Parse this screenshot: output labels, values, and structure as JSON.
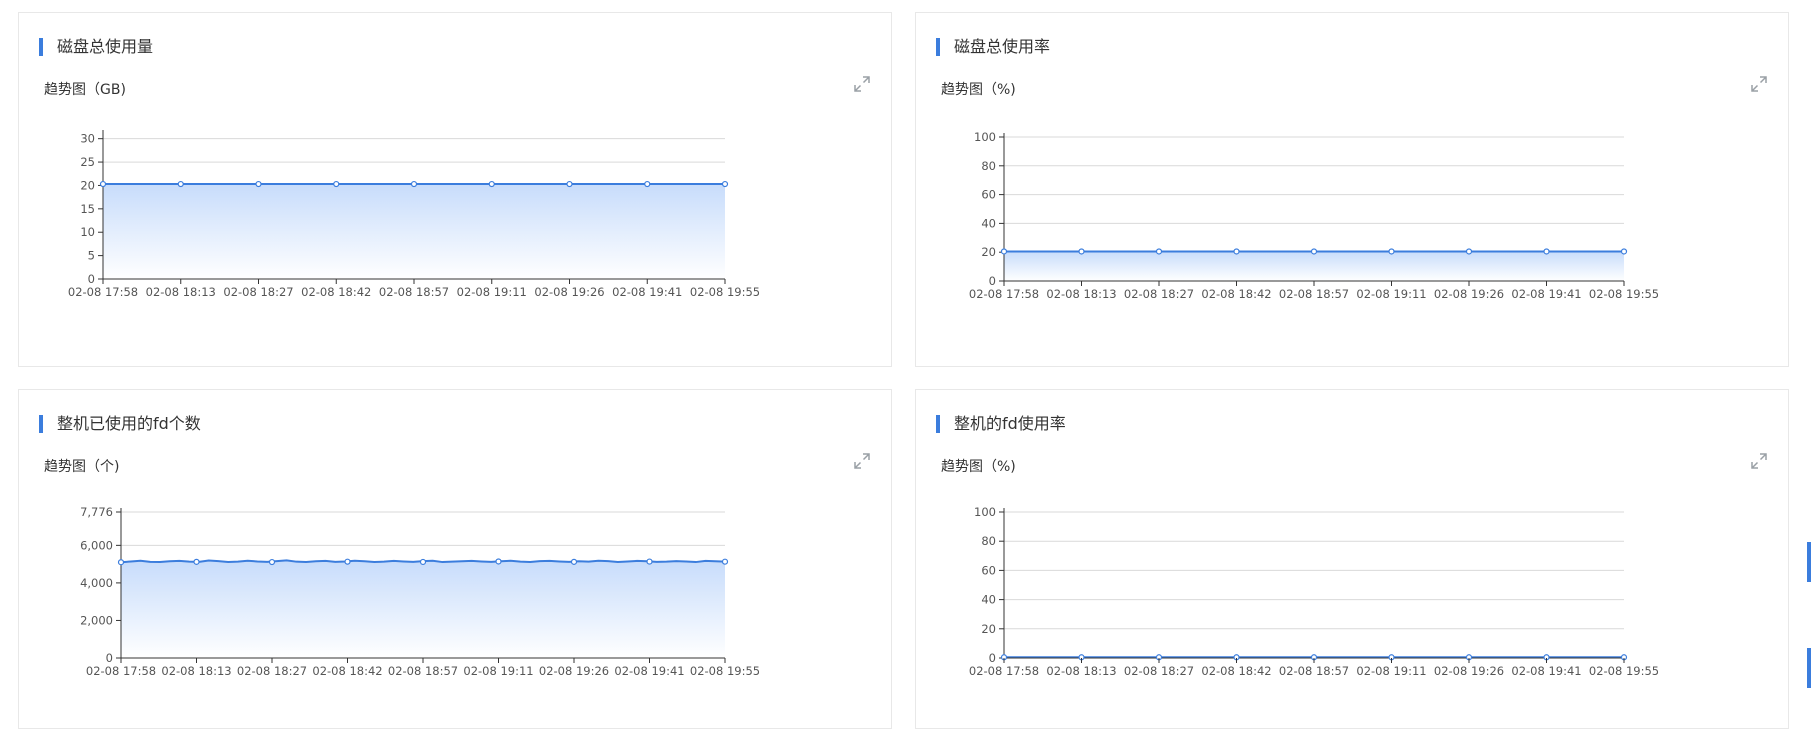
{
  "accent_color": "#3b7ddd",
  "icons": {
    "expand": "expand-icon"
  },
  "panels": [
    {
      "title": "磁盘总使用量",
      "subtitle": "趋势图（GB)"
    },
    {
      "title": "磁盘总使用率",
      "subtitle": "趋势图（%)"
    },
    {
      "title": "整机已使用的fd个数",
      "subtitle": "趋势图（个)"
    },
    {
      "title": "整机的fd使用率",
      "subtitle": "趋势图（%)"
    }
  ],
  "chart_data": [
    {
      "type": "area",
      "title": "磁盘总使用量",
      "x": [
        "02-08 17:58",
        "02-08 18:13",
        "02-08 18:27",
        "02-08 18:42",
        "02-08 18:57",
        "02-08 19:11",
        "02-08 19:26",
        "02-08 19:41",
        "02-08 19:55"
      ],
      "yticks": [
        0,
        5,
        10,
        15,
        20,
        25,
        30
      ],
      "ylim": [
        0,
        31
      ],
      "grid": true,
      "legend": "none",
      "series": [
        {
          "values": [
            20.3,
            20.3,
            20.3,
            20.3,
            20.3,
            20.3,
            20.3,
            20.3,
            20.3
          ]
        }
      ]
    },
    {
      "type": "area",
      "title": "磁盘总使用率",
      "x": [
        "02-08 17:58",
        "02-08 18:13",
        "02-08 18:27",
        "02-08 18:42",
        "02-08 18:57",
        "02-08 19:11",
        "02-08 19:26",
        "02-08 19:41",
        "02-08 19:55"
      ],
      "yticks": [
        0,
        20,
        40,
        60,
        80,
        100
      ],
      "ylim": [
        0,
        100
      ],
      "grid": true,
      "legend": "none",
      "series": [
        {
          "values": [
            20.5,
            20.5,
            20.5,
            20.5,
            20.5,
            20.5,
            20.5,
            20.5,
            20.5
          ]
        }
      ]
    },
    {
      "type": "area",
      "title": "整机已使用的fd个数",
      "x": [
        "02-08 17:58",
        "02-08 18:13",
        "02-08 18:27",
        "02-08 18:42",
        "02-08 18:57",
        "02-08 19:11",
        "02-08 19:26",
        "02-08 19:41",
        "02-08 19:55"
      ],
      "ytick_labels": [
        "0",
        "2,000",
        "4,000",
        "6,000",
        "7,776"
      ],
      "yticks": [
        0,
        2000,
        4000,
        6000,
        7776
      ],
      "ylim": [
        0,
        7776
      ],
      "grid": true,
      "legend": "none",
      "series": [
        {
          "values": [
            5100,
            5120,
            5110,
            5130,
            5115,
            5140,
            5120,
            5135,
            5130
          ],
          "detail_values": [
            5100,
            5140,
            5180,
            5120,
            5110,
            5150,
            5170,
            5130,
            5120,
            5190,
            5160,
            5110,
            5130,
            5180,
            5140,
            5120,
            5160,
            5200,
            5130,
            5110,
            5150,
            5170,
            5120,
            5140,
            5180,
            5150,
            5110,
            5130,
            5170,
            5140,
            5120,
            5160,
            5180,
            5110,
            5130,
            5150,
            5170,
            5140,
            5120,
            5150,
            5180,
            5130,
            5110,
            5160,
            5170,
            5140,
            5120,
            5150,
            5130,
            5180,
            5160,
            5110,
            5140,
            5170,
            5150,
            5120,
            5130,
            5160,
            5140,
            5110,
            5170,
            5150,
            5130
          ]
        }
      ]
    },
    {
      "type": "area",
      "title": "整机的fd使用率",
      "x": [
        "02-08 17:58",
        "02-08 18:13",
        "02-08 18:27",
        "02-08 18:42",
        "02-08 18:57",
        "02-08 19:11",
        "02-08 19:26",
        "02-08 19:41",
        "02-08 19:55"
      ],
      "yticks": [
        0,
        20,
        40,
        60,
        80,
        100
      ],
      "ylim": [
        0,
        100
      ],
      "grid": true,
      "legend": "none",
      "series": [
        {
          "values": [
            0.5,
            0.5,
            0.5,
            0.5,
            0.5,
            0.5,
            0.5,
            0.5,
            0.5
          ]
        }
      ]
    }
  ]
}
